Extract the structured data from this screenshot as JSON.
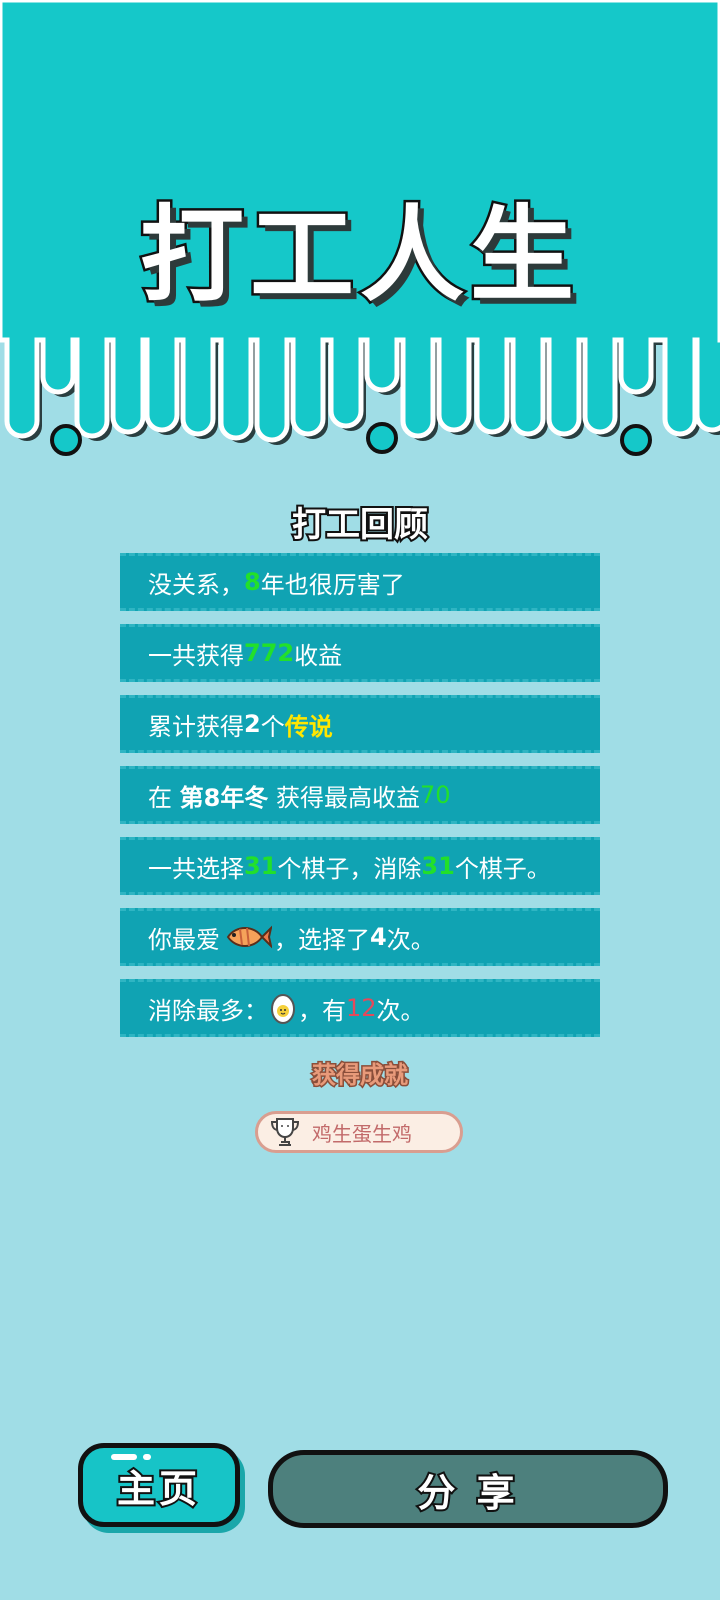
{
  "game_title": "打工人生",
  "review": {
    "title": "打工回顾",
    "rows": [
      {
        "parts": [
          "没关系，",
          "8",
          "年也很厉害了"
        ]
      },
      {
        "parts": [
          "一共获得",
          "772",
          "收益"
        ]
      },
      {
        "parts": [
          "累计获得",
          "2",
          "个",
          "传说"
        ]
      },
      {
        "parts": [
          "在 ",
          "第8年冬",
          " 获得最高收益",
          "70"
        ]
      },
      {
        "parts": [
          "一共选择",
          "31",
          "个棋子，消除",
          "31",
          "个棋子。"
        ]
      },
      {
        "parts": [
          "你最爱",
          "，选择了",
          "4",
          "次。"
        ],
        "icon": "fish-icon"
      },
      {
        "parts": [
          "消除最多：",
          "，有",
          "12",
          "次。"
        ],
        "icon": "egg-icon"
      }
    ]
  },
  "achievements": {
    "title": "获得成就",
    "badge_label": "鸡生蛋生鸡",
    "badge_icon": "trophy-icon"
  },
  "buttons": {
    "home_label": "主页",
    "share_label": "分 享"
  },
  "colors": {
    "top_background": "#15c8c9",
    "page_background": "#a0dde6",
    "row_background": "#10a3b3",
    "highlight_green": "#22e02a",
    "highlight_yellow": "#ffe600",
    "highlight_red": "#e5495b",
    "home_button": "#17c4c7",
    "share_button": "#4d807d"
  }
}
